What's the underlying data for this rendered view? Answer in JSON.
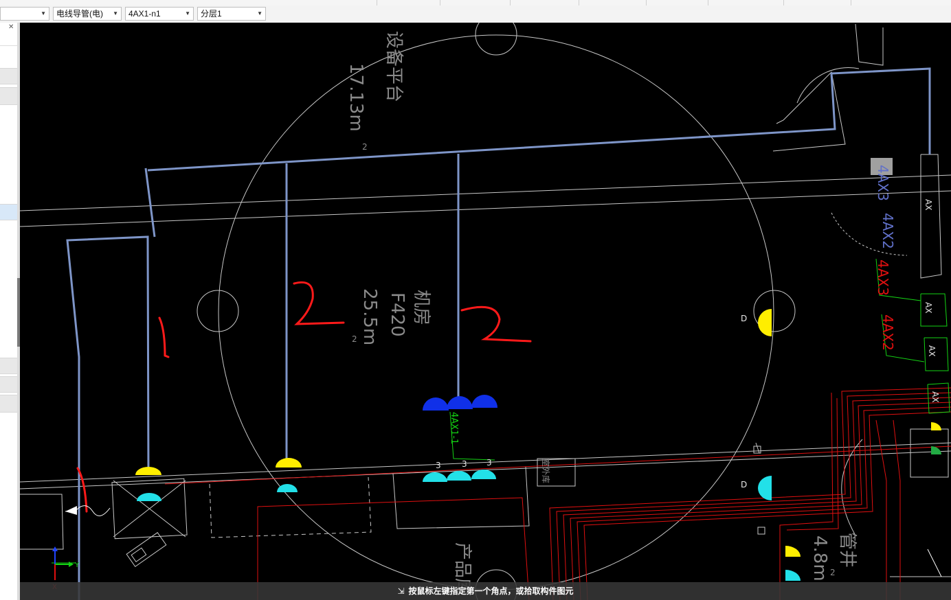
{
  "toolbar": {
    "combo_1": "",
    "combo_2": "电线导管(电)",
    "combo_3": "4AX1-n1",
    "combo_4": "分层1"
  },
  "left_panel": {
    "close_glyph": "✕"
  },
  "drawing": {
    "room_upper": {
      "name": "设备平台",
      "area_value": "17.13m",
      "area_sup": "2"
    },
    "room_center": {
      "name": "机房",
      "code": "F420",
      "area_value": "25.5m",
      "area_sup": "2"
    },
    "room_right": {
      "name": "管井",
      "area_value": "4.8m",
      "area_sup": "2"
    },
    "labels": {
      "ax3_right": "4AX3",
      "ax2_right": "4AX2",
      "ax3_red": "4AX3",
      "ax2_red": "4AX2",
      "circuit": "4AX1-1",
      "box_ax": "AX",
      "count_3": "3",
      "lamp_mark": "D",
      "outer_room": "室外库",
      "lower_room": "产品库"
    },
    "annotations": {
      "mark_1": "1",
      "mark_2a": "2",
      "mark_2b": "2"
    }
  },
  "ucs": {
    "x_label": "X",
    "y_label": "Y"
  },
  "status": {
    "message": "按鼠标左键指定第一个角点，或拾取构件图元"
  },
  "colors": {
    "pipe": "#7e95c8",
    "wall": "#c8c8c8",
    "red": "#e01010",
    "green": "#14d414",
    "yellow": "#ffee00",
    "cyan": "#22e0e8",
    "blue": "#1030e8"
  }
}
